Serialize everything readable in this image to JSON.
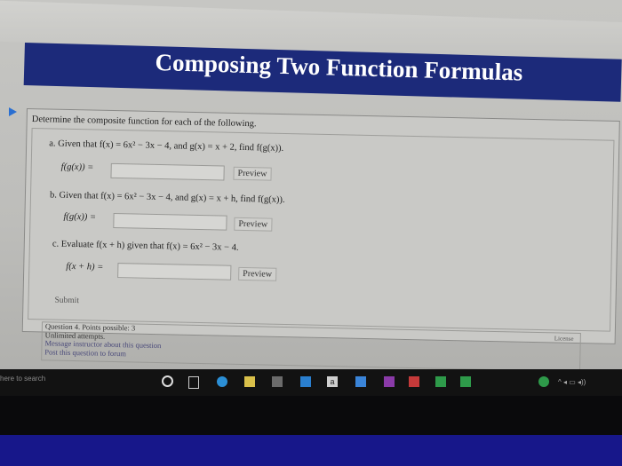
{
  "page_title": "Composing Two Function Formulas",
  "intro": "Determine the composite function for each of the following.",
  "questions": {
    "a": "a. Given that f(x) = 6x² − 3x − 4, and g(x) = x + 2, find f(g(x)).",
    "b": "b. Given that f(x) = 6x² − 3x − 4, and g(x) = x + h, find f(g(x)).",
    "c": "c. Evaluate f(x + h) given that f(x) = 6x² − 3x − 4."
  },
  "answers": {
    "a_label": "f(g(x)) =",
    "b_label": "f(g(x)) =",
    "c_label": "f(x + h) =",
    "a_value": "",
    "b_value": "",
    "c_value": ""
  },
  "preview_label": "Preview",
  "submit_label": "Submit",
  "info": {
    "line1": "Question 4. Points possible: 3",
    "line2": "Unlimited attempts.",
    "line3": "Message instructor about this question",
    "line4": "Post this question to forum"
  },
  "license_label": "License",
  "taskbar": {
    "search_text": "here to search",
    "tray_letter": "a"
  },
  "colors": {
    "banner": "#1c2a7a",
    "accent_triangle": "#2a6fd1",
    "taskbar": "#121212",
    "bezel_strip": "#17178a"
  },
  "icons": [
    "triangle-icon",
    "cortana-icon",
    "taskview-icon",
    "chrome-icon",
    "file-explorer-icon",
    "store-icon",
    "mail-icon",
    "word-icon",
    "dropbox-icon",
    "onenote-icon"
  ]
}
